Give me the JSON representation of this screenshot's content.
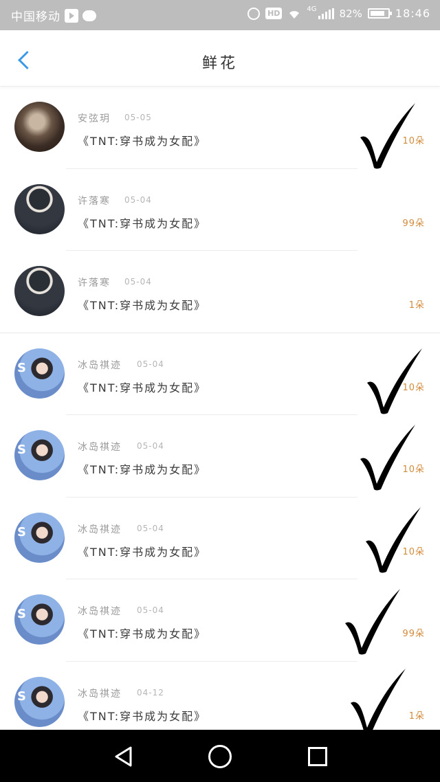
{
  "status_bar": {
    "carrier": "中国移动",
    "network": "4G",
    "battery": "82%",
    "time": "18:46",
    "icons": [
      "play-icon",
      "chat-bubble-icon",
      "alarm-icon",
      "hd-icon",
      "wifi-icon",
      "signal-icon",
      "battery-icon"
    ]
  },
  "header": {
    "title": "鲜花",
    "back_icon": "chevron-left-icon"
  },
  "accent_color": "#3a9ae8",
  "count_color": "#d28a3a",
  "rows": [
    {
      "name": "安弦玥",
      "date": "05-05",
      "book": "《TNT:穿书成为女配》",
      "count": "10朵",
      "avatar": "a1",
      "checked": true
    },
    {
      "name": "许落寒",
      "date": "05-04",
      "book": "《TNT:穿书成为女配》",
      "count": "99朵",
      "avatar": "a2",
      "checked": false
    },
    {
      "name": "许落寒",
      "date": "05-04",
      "book": "《TNT:穿书成为女配》",
      "count": "1朵",
      "avatar": "a2",
      "checked": false
    },
    {
      "name": "冰岛祺迹",
      "date": "05-04",
      "book": "《TNT:穿书成为女配》",
      "count": "10朵",
      "avatar": "a3",
      "checked": true
    },
    {
      "name": "冰岛祺迹",
      "date": "05-04",
      "book": "《TNT:穿书成为女配》",
      "count": "10朵",
      "avatar": "a3",
      "checked": true
    },
    {
      "name": "冰岛祺迹",
      "date": "05-04",
      "book": "《TNT:穿书成为女配》",
      "count": "10朵",
      "avatar": "a3",
      "checked": true
    },
    {
      "name": "冰岛祺迹",
      "date": "05-04",
      "book": "《TNT:穿书成为女配》",
      "count": "99朵",
      "avatar": "a3",
      "checked": true
    },
    {
      "name": "冰岛祺迹",
      "date": "04-12",
      "book": "《TNT:穿书成为女配》",
      "count": "1朵",
      "avatar": "a3",
      "checked": true
    }
  ],
  "nav_bar": {
    "icons": [
      "nav-back-icon",
      "nav-home-icon",
      "nav-recent-apps-icon"
    ]
  }
}
